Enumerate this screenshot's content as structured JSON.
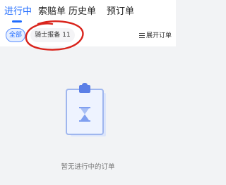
{
  "tabs": [
    {
      "label": "进行中",
      "active": true
    },
    {
      "label": "索赔单",
      "active": false
    },
    {
      "label": "历史单",
      "active": false
    },
    {
      "label": "预订单",
      "active": false
    }
  ],
  "filters": {
    "all_label": "全部",
    "knight_label": "骑士报备",
    "knight_count": "11",
    "expand_label": "展开订单",
    "expand_icon": "list-icon"
  },
  "empty_state": {
    "icon": "clipboard-hourglass-icon",
    "message": "暂无进行中的订单"
  },
  "colors": {
    "accent": "#1f6bff",
    "background": "#f2f3f5",
    "annotation": "#d9241c"
  }
}
